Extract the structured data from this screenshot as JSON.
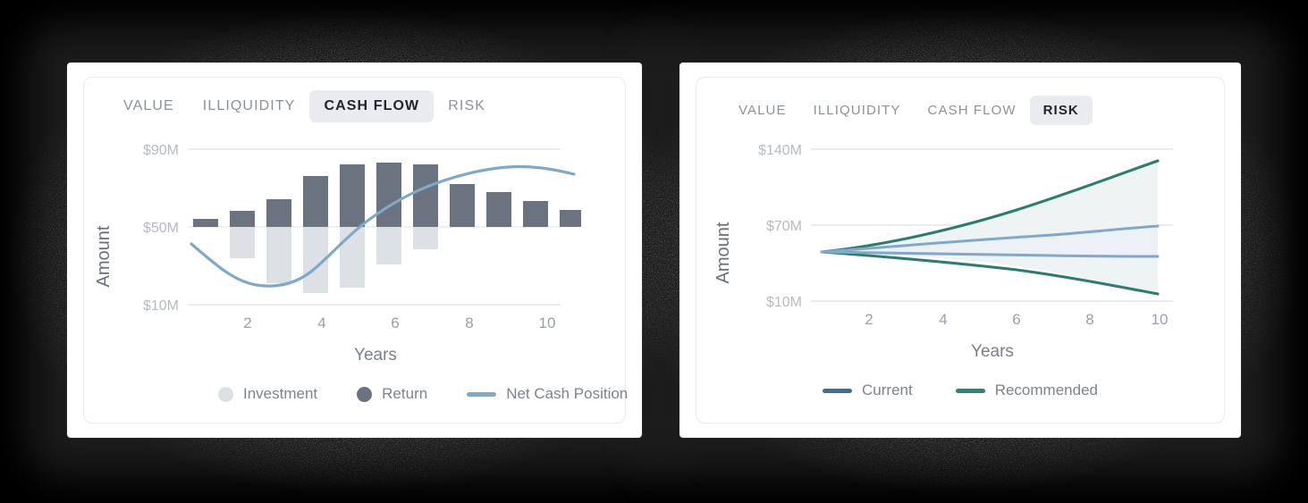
{
  "background": {
    "color": "#000000",
    "card_color": "#ffffff"
  },
  "theme": {
    "tab_active_bg": "#e9ebee",
    "tab_active_text": "#212529",
    "tab_text": "#8c9199",
    "bar_return": "#6b7280",
    "bar_investment": "#dde1e6",
    "line_net_cash": "#7fa9c9",
    "line_current": "#3d6e96",
    "line_current_band": "#7fa8cc",
    "line_recommended": "#2d7d6e",
    "band_fill": "#eef3f3",
    "grid": "#e4e7ea",
    "tick_text": "#b6bbc2"
  },
  "cards": [
    {
      "id": "cash-flow-card",
      "tabs": [
        {
          "label": "VALUE",
          "active": false
        },
        {
          "label": "ILLIQUIDITY",
          "active": false
        },
        {
          "label": "CASH FLOW",
          "active": true
        },
        {
          "label": "RISK",
          "active": false
        }
      ],
      "legend": [
        {
          "label": "Investment",
          "marker": "dot",
          "color": "#dde1e6"
        },
        {
          "label": "Return",
          "marker": "dot",
          "color": "#6b7280"
        },
        {
          "label": "Net Cash Position",
          "marker": "line",
          "color": "#7fa9c9"
        }
      ]
    },
    {
      "id": "risk-card",
      "tabs": [
        {
          "label": "VALUE",
          "active": false
        },
        {
          "label": "ILLIQUIDITY",
          "active": false
        },
        {
          "label": "CASH FLOW",
          "active": false
        },
        {
          "label": "RISK",
          "active": true
        }
      ],
      "legend": [
        {
          "label": "Current",
          "marker": "line",
          "color": "#3d6e96"
        },
        {
          "label": "Recommended",
          "marker": "line",
          "color": "#2d8574"
        }
      ]
    }
  ],
  "chart_data": [
    {
      "type": "bar",
      "id": "cash-flow-chart",
      "title": "",
      "xlabel": "Years",
      "ylabel": "Amount",
      "x": [
        1,
        2,
        3,
        4,
        5,
        6,
        7,
        8,
        9,
        10
      ],
      "xticks": [
        2,
        4,
        6,
        8,
        10
      ],
      "xticklabels": [
        "2",
        "4",
        "6",
        "8",
        "10"
      ],
      "yticks": [
        10,
        50,
        90
      ],
      "yticklabels": [
        "$10M",
        "$50M",
        "$90M"
      ],
      "ylim": [
        10,
        90
      ],
      "baseline": 50,
      "grid": true,
      "legend_position": "bottom-left",
      "series": [
        {
          "name": "Return",
          "type": "bar",
          "color": "#6b7280",
          "direction": "up-from-baseline",
          "values": [
            54,
            58,
            64,
            76,
            82,
            83,
            82,
            72,
            68,
            65,
            60
          ]
        },
        {
          "name": "Investment",
          "type": "bar",
          "color": "#dde1e6",
          "direction": "down-from-baseline",
          "values": [
            50,
            34,
            21,
            17,
            20,
            35,
            42,
            50,
            50,
            50,
            50
          ]
        },
        {
          "name": "Net Cash Position",
          "type": "line",
          "color": "#7fa9c9",
          "values": [
            45,
            36,
            30,
            29,
            33,
            46,
            62,
            74,
            79,
            81,
            80
          ]
        }
      ]
    },
    {
      "type": "line",
      "id": "risk-chart",
      "title": "",
      "xlabel": "Years",
      "ylabel": "Amount",
      "x": [
        1,
        2,
        3,
        4,
        5,
        6,
        7,
        8,
        9,
        10
      ],
      "xticks": [
        2,
        4,
        6,
        8,
        10
      ],
      "xticklabels": [
        "2",
        "4",
        "6",
        "8",
        "10"
      ],
      "yticks": [
        10,
        70,
        140
      ],
      "yticklabels": [
        "$10M",
        "$70M",
        "$140M"
      ],
      "ylim": [
        10,
        140
      ],
      "grid": true,
      "legend_position": "bottom-center",
      "series": [
        {
          "name": "Current upper",
          "group": "Current",
          "color": "#7fa8cc",
          "values": [
            50,
            53,
            56,
            59,
            62,
            64,
            66,
            68,
            70,
            72
          ]
        },
        {
          "name": "Current lower",
          "group": "Current",
          "color": "#7fa8cc",
          "values": [
            50,
            50,
            50,
            50,
            50,
            50,
            50,
            49,
            49,
            48
          ]
        },
        {
          "name": "Recommended upper",
          "group": "Recommended",
          "color": "#2d7d6e",
          "values": [
            50,
            55,
            62,
            71,
            82,
            94,
            104,
            114,
            124,
            134
          ]
        },
        {
          "name": "Recommended lower",
          "group": "Recommended",
          "color": "#2d7d6e",
          "values": [
            50,
            47,
            44,
            40,
            36,
            32,
            28,
            24,
            20,
            16
          ]
        }
      ]
    }
  ]
}
